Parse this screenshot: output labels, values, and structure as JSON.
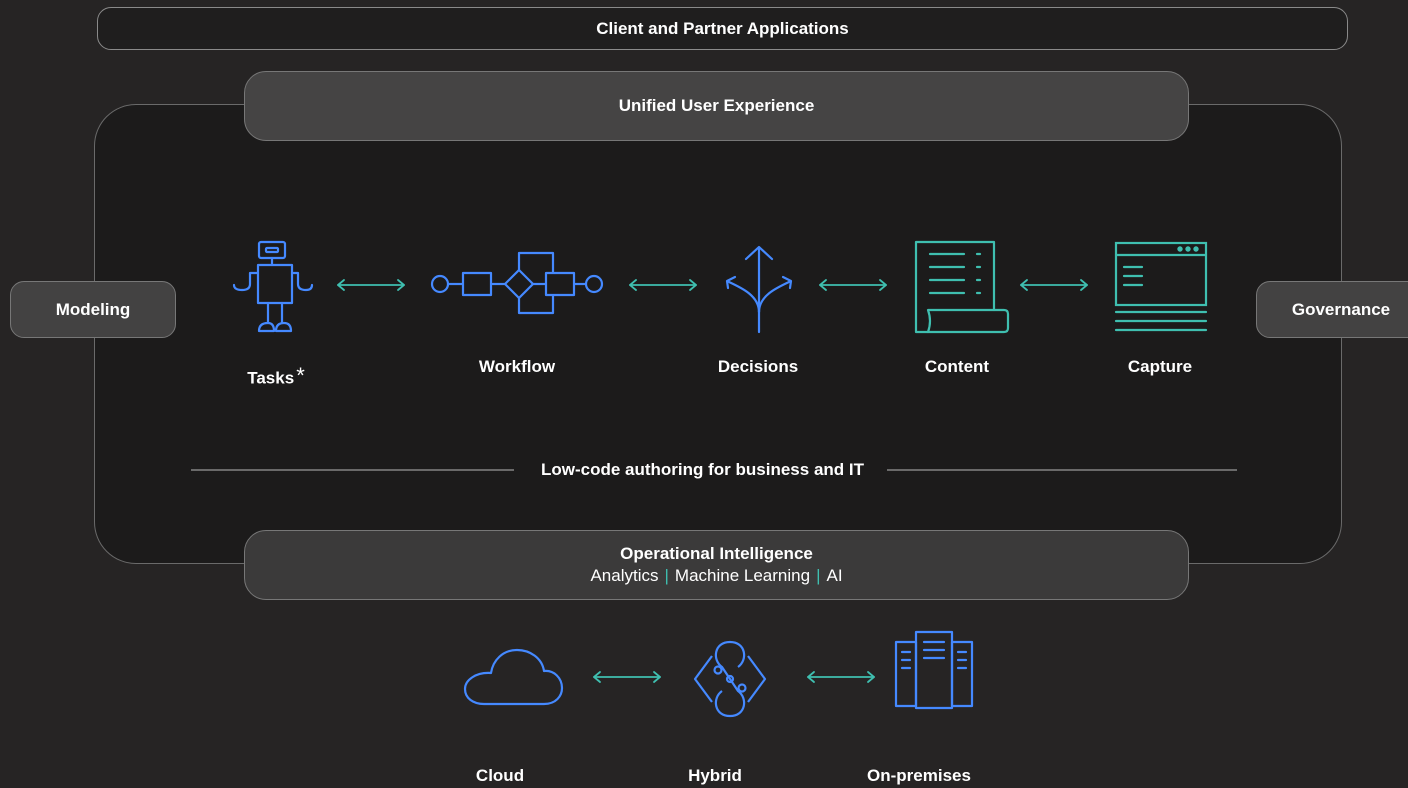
{
  "top_bar": {
    "label": "Client and Partner Applications"
  },
  "ux_bar": {
    "label": "Unified User Experience"
  },
  "side": {
    "left": "Modeling",
    "right": "Governance"
  },
  "capabilities": {
    "tasks": "Tasks",
    "tasks_mark": "*",
    "workflow": "Workflow",
    "decisions": "Decisions",
    "content": "Content",
    "capture": "Capture"
  },
  "lowcode": "Low-code authoring for business and IT",
  "ops": {
    "title": "Operational Intelligence",
    "items": [
      "Analytics",
      "Machine Learning",
      "AI"
    ],
    "separator": "|"
  },
  "deployment": {
    "cloud": "Cloud",
    "hybrid": "Hybrid",
    "onprem": "On-premises"
  },
  "colors": {
    "blue": "#4589ff",
    "teal": "#3fbfb0",
    "background": "#262424"
  },
  "icons": [
    "robot-icon",
    "workflow-icon",
    "decision-arrows-icon",
    "document-icon",
    "capture-window-icon",
    "cloud-icon",
    "hybrid-icon",
    "server-icon",
    "bidirectional-arrow-icon"
  ]
}
